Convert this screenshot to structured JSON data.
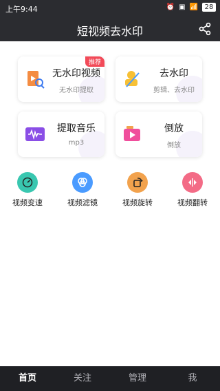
{
  "status": {
    "time": "上午9:44",
    "battery": "28"
  },
  "header": {
    "title": "短视频去水印"
  },
  "cards": [
    {
      "title": "无水印视频",
      "subtitle": "无水印提取",
      "badge": "推荐",
      "icon": "video-file-search-icon"
    },
    {
      "title": "去水印",
      "subtitle": "剪辑、去水印",
      "icon": "watermark-remove-icon"
    },
    {
      "title": "提取音乐",
      "subtitle": "mp3",
      "icon": "audio-wave-icon"
    },
    {
      "title": "倒放",
      "subtitle": "倒放",
      "icon": "reverse-play-icon"
    }
  ],
  "tools": [
    {
      "label": "视频变速",
      "icon": "speed-icon",
      "color": "#39c7b0"
    },
    {
      "label": "视频滤镜",
      "icon": "filter-icon",
      "color": "#4a9bff"
    },
    {
      "label": "视频旋转",
      "icon": "rotate-icon",
      "color": "#f2a24d"
    },
    {
      "label": "视频翻转",
      "icon": "flip-icon",
      "color": "#f36b86"
    }
  ],
  "nav": [
    {
      "label": "首页",
      "active": true
    },
    {
      "label": "关注"
    },
    {
      "label": "管理"
    },
    {
      "label": "我"
    }
  ],
  "colors": {
    "header_bg": "#2b2c30",
    "bottom_nav_bg": "#1f2024",
    "badge": "#f24a58"
  }
}
